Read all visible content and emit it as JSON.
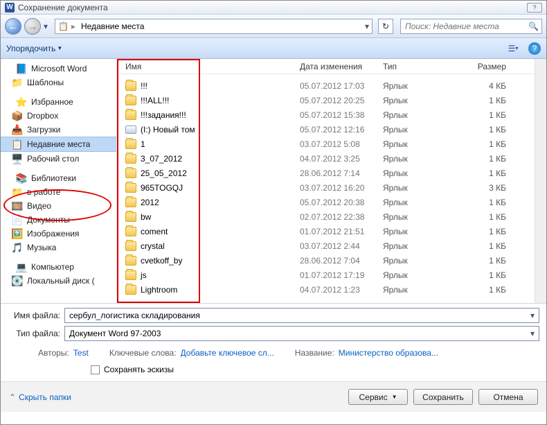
{
  "title": "Сохранение документа",
  "breadcrumb": {
    "location": "Недавние места"
  },
  "search": {
    "placeholder": "Поиск: Недавние места"
  },
  "toolbar": {
    "organize": "Упорядочить"
  },
  "sidebar": {
    "word": {
      "label": "Microsoft Word",
      "templates": "Шаблоны"
    },
    "fav": {
      "label": "Избранное",
      "dropbox": "Dropbox",
      "downloads": "Загрузки",
      "recent": "Недавние места",
      "desktop": "Рабочий стол"
    },
    "libs": {
      "label": "Библиотеки",
      "work": "в работе",
      "video": "Видео",
      "docs": "Документы",
      "pics": "Изображения",
      "music": "Музыка"
    },
    "pc": {
      "label": "Компьютер",
      "disk": "Локальный диск ("
    }
  },
  "columns": {
    "name": "Имя",
    "date": "Дата изменения",
    "type": "Тип",
    "size": "Размер"
  },
  "files": [
    {
      "icon": "folder",
      "name": "!!!",
      "date": "05.07.2012 17:03",
      "type": "Ярлык",
      "size": "4 КБ"
    },
    {
      "icon": "folder",
      "name": "!!!ALL!!!",
      "date": "05.07.2012 20:25",
      "type": "Ярлык",
      "size": "1 КБ"
    },
    {
      "icon": "folder",
      "name": "!!!задания!!!",
      "date": "05.07.2012 15:38",
      "type": "Ярлык",
      "size": "1 КБ"
    },
    {
      "icon": "drive",
      "name": "(I:) Новый том",
      "date": "05.07.2012 12:16",
      "type": "Ярлык",
      "size": "1 КБ"
    },
    {
      "icon": "folder",
      "name": "1",
      "date": "03.07.2012 5:08",
      "type": "Ярлык",
      "size": "1 КБ"
    },
    {
      "icon": "folder",
      "name": "3_07_2012",
      "date": "04.07.2012 3:25",
      "type": "Ярлык",
      "size": "1 КБ"
    },
    {
      "icon": "folder",
      "name": "25_05_2012",
      "date": "28.06.2012 7:14",
      "type": "Ярлык",
      "size": "1 КБ"
    },
    {
      "icon": "folder",
      "name": "965TOGQJ",
      "date": "03.07.2012 16:20",
      "type": "Ярлык",
      "size": "3 КБ"
    },
    {
      "icon": "folder",
      "name": "2012",
      "date": "05.07.2012 20:38",
      "type": "Ярлык",
      "size": "1 КБ"
    },
    {
      "icon": "folder",
      "name": "bw",
      "date": "02.07.2012 22:38",
      "type": "Ярлык",
      "size": "1 КБ"
    },
    {
      "icon": "folder",
      "name": "coment",
      "date": "01.07.2012 21:51",
      "type": "Ярлык",
      "size": "1 КБ"
    },
    {
      "icon": "folder",
      "name": "crystal",
      "date": "03.07.2012 2:44",
      "type": "Ярлык",
      "size": "1 КБ"
    },
    {
      "icon": "folder",
      "name": "cvetkoff_by",
      "date": "28.06.2012 7:04",
      "type": "Ярлык",
      "size": "1 КБ"
    },
    {
      "icon": "folder",
      "name": "js",
      "date": "01.07.2012 17:19",
      "type": "Ярлык",
      "size": "1 КБ"
    },
    {
      "icon": "folder",
      "name": "Lightroom",
      "date": "04.07.2012 1:23",
      "type": "Ярлык",
      "size": "1 КБ"
    }
  ],
  "form": {
    "filename_label": "Имя файла:",
    "filename_value": "сербул_логистика складирования",
    "filetype_label": "Тип файла:",
    "filetype_value": "Документ Word 97-2003",
    "authors_label": "Авторы:",
    "authors_value": "Test",
    "keywords_label": "Ключевые слова:",
    "keywords_value": "Добавьте ключевое сл...",
    "title_label": "Название:",
    "title_value": "Министерство образова...",
    "thumbs_label": "Сохранять эскизы"
  },
  "buttons": {
    "hide": "Скрыть папки",
    "tools": "Сервис",
    "save": "Сохранить",
    "cancel": "Отмена"
  }
}
